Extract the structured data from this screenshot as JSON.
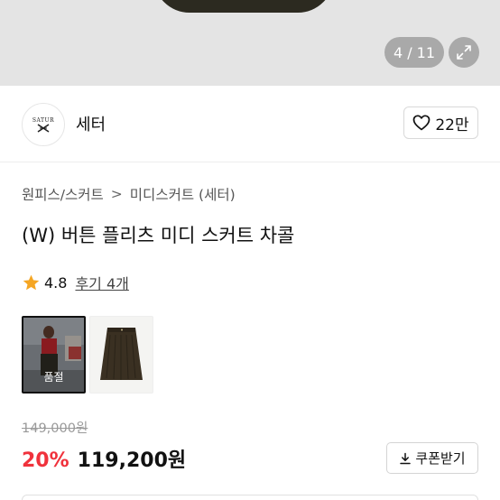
{
  "gallery": {
    "counter": "4 / 11",
    "expand_icon": "expand-icon"
  },
  "brand": {
    "logo_text": "SATUR",
    "name": "세터",
    "like_count": "22만",
    "like_icon": "heart-outline-icon"
  },
  "breadcrumb": {
    "items": [
      "원피스/스커트",
      "미디스커트 (세터)"
    ],
    "separator": ">"
  },
  "product": {
    "title": "(W) 버튼 플리츠 미디 스커트 차콜",
    "rating": "4.8",
    "reviews_label": "후기 4개",
    "thumbnails": [
      {
        "label": "품절",
        "selected": true
      },
      {
        "label": "",
        "selected": false
      }
    ],
    "original_price": "149,000원",
    "discount": "20%",
    "price": "119,200원",
    "coupon_label": "쿠폰받기"
  },
  "colors": {
    "discount": "#f0323c",
    "star": "#f5a623"
  }
}
